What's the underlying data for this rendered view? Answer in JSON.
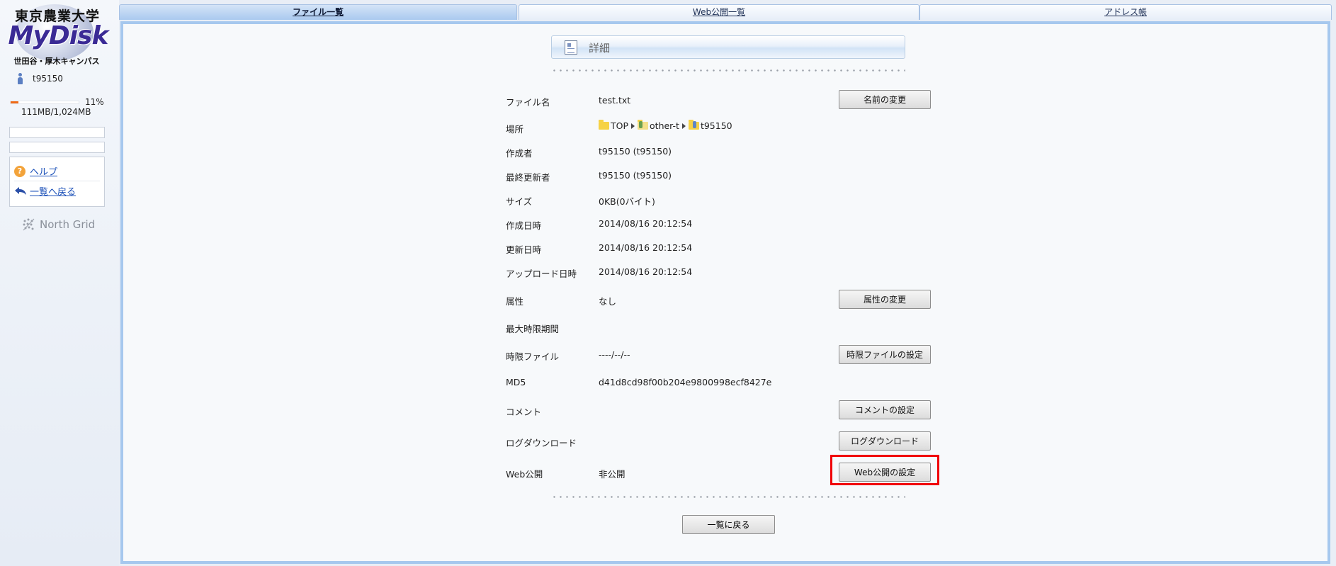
{
  "sidebar": {
    "logo": {
      "university": "東京農業大学",
      "brand": "MyDisk",
      "campus": "世田谷・厚木キャンパス"
    },
    "user_name": "t95150",
    "quota": {
      "percent_label": "11%",
      "fraction": 0.11,
      "usage": "111MB/1,024MB"
    },
    "menu": [
      {
        "label": "ヘルプ",
        "icon": "help-icon"
      },
      {
        "label": "一覧へ戻る",
        "icon": "back-arrow-icon"
      }
    ],
    "vendor_logo": "North Grid"
  },
  "tabs": [
    {
      "label": "ファイル一覧",
      "active": true
    },
    {
      "label": "Web公開一覧",
      "active": false
    },
    {
      "label": "アドレス帳",
      "active": false
    }
  ],
  "detail": {
    "title": "詳細",
    "fields": {
      "file_name": {
        "label": "ファイル名",
        "value": "test.txt",
        "button": "名前の変更"
      },
      "location": {
        "label": "場所",
        "path": [
          {
            "name": "TOP",
            "icon": "folder-icon"
          },
          {
            "name": "other-t",
            "icon": "shared-folder-icon"
          },
          {
            "name": "t95150",
            "icon": "user-folder-icon"
          }
        ]
      },
      "creator": {
        "label": "作成者",
        "value": "t95150 (t95150)"
      },
      "last_updater": {
        "label": "最終更新者",
        "value": "t95150 (t95150)"
      },
      "size": {
        "label": "サイズ",
        "value": "0KB(0バイト)"
      },
      "created_at": {
        "label": "作成日時",
        "value": "2014/08/16 20:12:54"
      },
      "updated_at": {
        "label": "更新日時",
        "value": "2014/08/16 20:12:54"
      },
      "uploaded_at": {
        "label": "アップロード日時",
        "value": "2014/08/16 20:12:54"
      },
      "attribute": {
        "label": "属性",
        "value": "なし",
        "button": "属性の変更"
      },
      "max_expiry": {
        "label": "最大時限期間",
        "value": ""
      },
      "expiry_file": {
        "label": "時限ファイル",
        "value": "----/--/--",
        "button": "時限ファイルの設定"
      },
      "md5": {
        "label": "MD5",
        "value": "d41d8cd98f00b204e9800998ecf8427e"
      },
      "comment": {
        "label": "コメント",
        "value": "",
        "button": "コメントの設定"
      },
      "log_download": {
        "label": "ログダウンロード",
        "value": "",
        "button": "ログダウンロード"
      },
      "web_publish": {
        "label": "Web公開",
        "value": "非公開",
        "button": "Web公開の設定"
      }
    },
    "back_button": "一覧に戻る"
  },
  "colors": {
    "quota_fill": "#f06a16",
    "highlight": "#f00008",
    "frame": "#a6c8ee",
    "link": "#1a4fb8"
  }
}
